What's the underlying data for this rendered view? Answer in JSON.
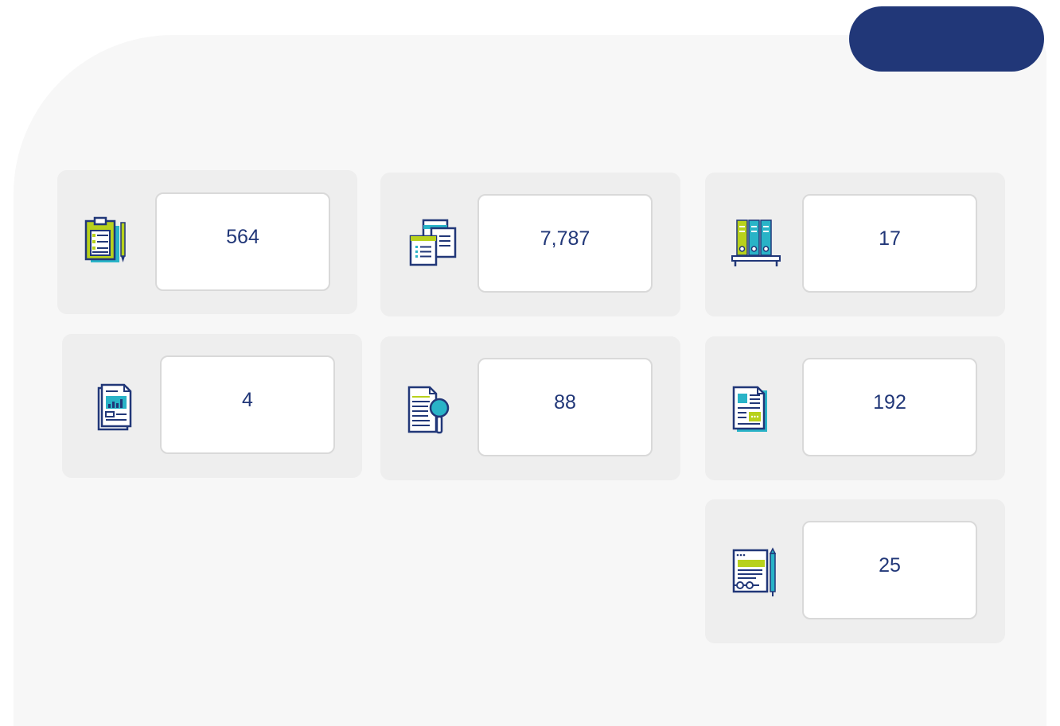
{
  "colors": {
    "navy": "#213778",
    "teal": "#29b3c7",
    "lime": "#b8d11c",
    "panel": "#f7f7f7",
    "card": "#eeeeee"
  },
  "top_pill": {
    "label": ""
  },
  "cards": [
    {
      "icon": "clipboard-checklist-icon",
      "value": "564"
    },
    {
      "icon": "stacked-documents-icon",
      "value": "7,787"
    },
    {
      "icon": "binders-on-shelf-icon",
      "value": "17"
    },
    {
      "icon": "report-chart-icon",
      "value": "4"
    },
    {
      "icon": "document-search-icon",
      "value": "88"
    },
    {
      "icon": "article-document-icon",
      "value": "192"
    },
    {
      "icon": "contract-glasses-pen-icon",
      "value": "25"
    }
  ]
}
